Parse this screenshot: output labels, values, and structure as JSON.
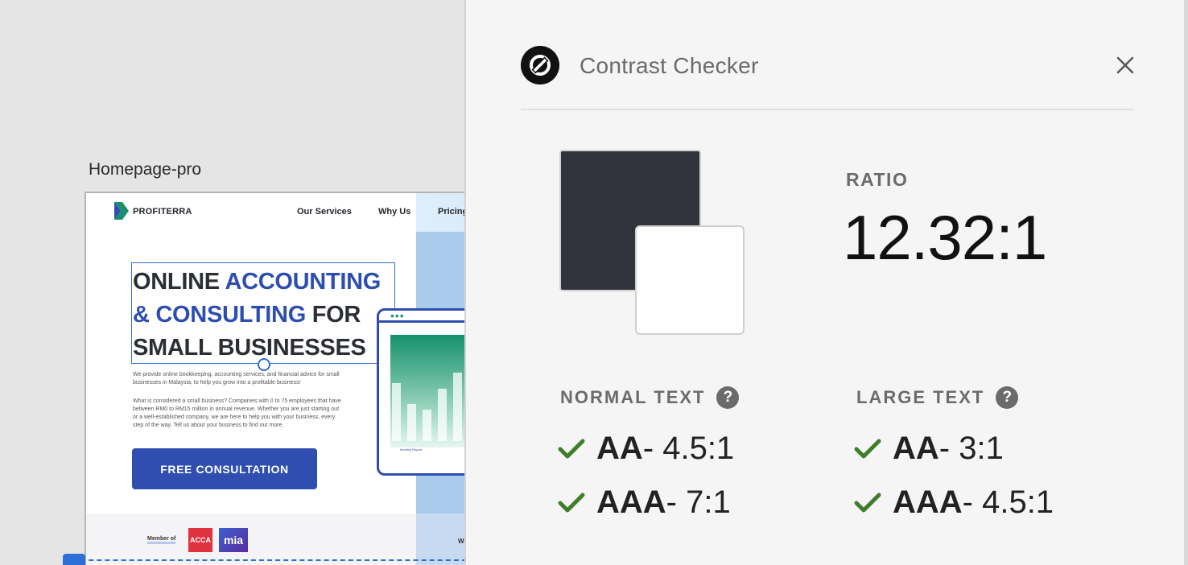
{
  "canvas": {
    "artboard_name": "Homepage-pro",
    "site": {
      "brand": "PROFITERRA",
      "nav": [
        "Our Services",
        "Why Us",
        "Pricing"
      ],
      "headline": {
        "line1_dark": "ONLINE ",
        "line1_accent": "ACCOUNTING",
        "line2_accent": "& CONSULTING",
        "line2_dark": " FOR",
        "line3_dark": "SMALL BUSINESSES"
      },
      "paragraph1": "We provide online bookkeeping, accounting services, and financial advice for small businesses in Malaysia, to help you grow into a profitable business!",
      "paragraph2": "What is considered a small business? Companies with 0 to 75 employees that have between RM0 to RM15 million in annual revenue. Whether you are just starting out or a well-established company, we are here to help you with your business, every step of the way. Tell us about your business to find out more.",
      "cta": "FREE CONSULTATION",
      "member_of": "Member of",
      "badge_acca": "ACCA",
      "badge_mia": "mia",
      "partial_text": "We",
      "mockup_caption": "Monthly Report",
      "mockup_bar_levels": [
        0.55,
        0.35,
        0.3,
        0.5,
        0.65
      ]
    }
  },
  "panel": {
    "title": "Contrast Checker",
    "foreground_color": "#30333b",
    "background_color": "#ffffff",
    "ratio_label": "RATIO",
    "ratio_value": "12.32:1",
    "normal_text": {
      "label": "NORMAL TEXT",
      "results": [
        {
          "level": "AA",
          "threshold": "- 4.5:1",
          "pass": true
        },
        {
          "level": "AAA",
          "threshold": "- 7:1",
          "pass": true
        }
      ]
    },
    "large_text": {
      "label": "LARGE TEXT",
      "results": [
        {
          "level": "AA",
          "threshold": "- 3:1",
          "pass": true
        },
        {
          "level": "AAA",
          "threshold": "- 4.5:1",
          "pass": true
        }
      ]
    },
    "help_glyph": "?",
    "pass_color": "#3f7d2c"
  }
}
